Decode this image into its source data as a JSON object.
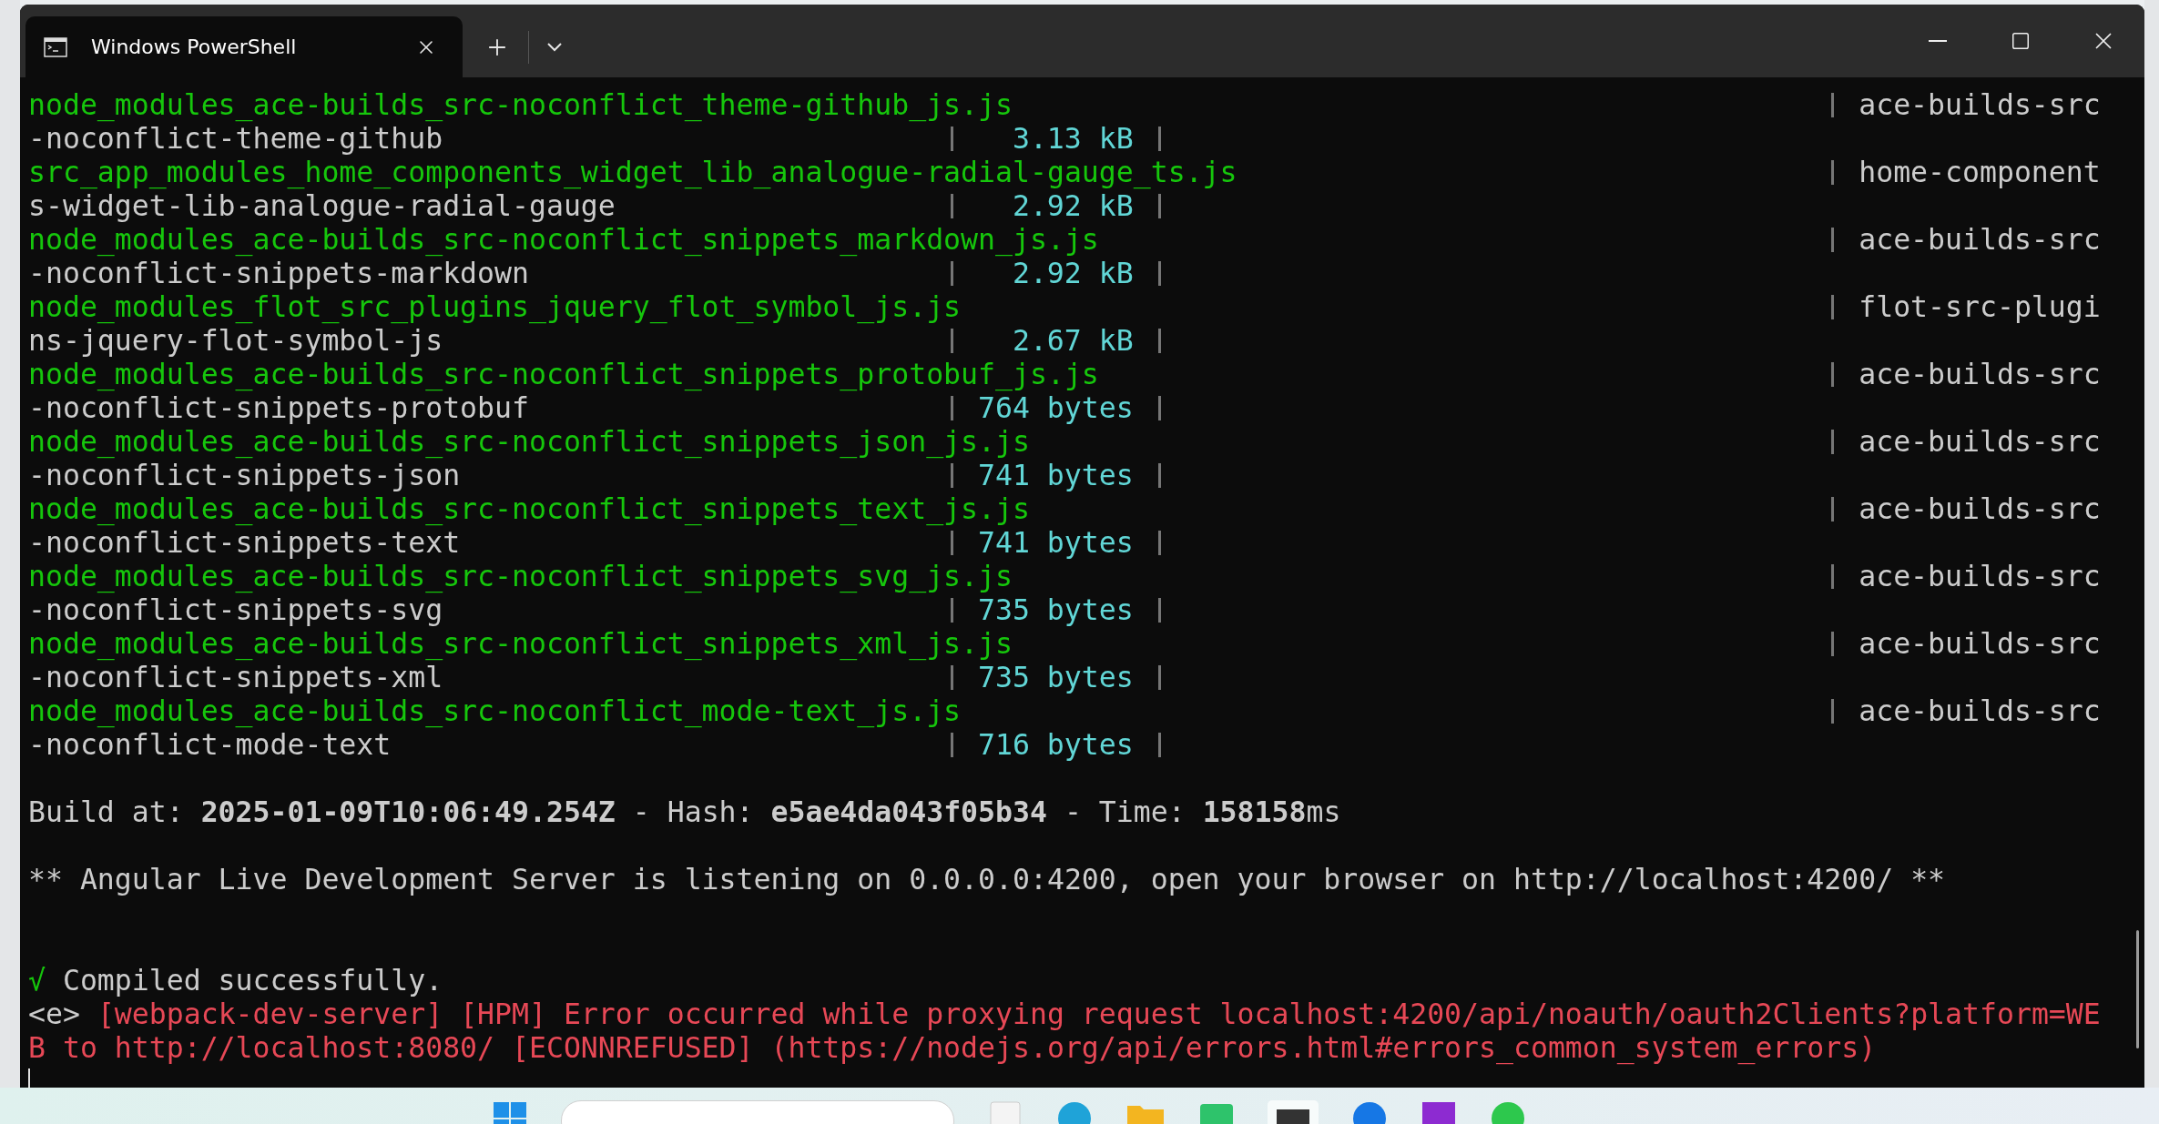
{
  "window": {
    "title": "Windows PowerShell"
  },
  "chunks": [
    {
      "file": "node_modules_ace-builds_src-noconflict_theme-github_js.js",
      "chunk": "-noconflict-theme-github",
      "size": "3.13 kB",
      "names": "ace-builds-src"
    },
    {
      "file": "src_app_modules_home_components_widget_lib_analogue-radial-gauge_ts.js",
      "chunk": "s-widget-lib-analogue-radial-gauge",
      "size": "2.92 kB",
      "names": "home-component"
    },
    {
      "file": "node_modules_ace-builds_src-noconflict_snippets_markdown_js.js",
      "chunk": "-noconflict-snippets-markdown",
      "size": "2.92 kB",
      "names": "ace-builds-src"
    },
    {
      "file": "node_modules_flot_src_plugins_jquery_flot_symbol_js.js",
      "chunk": "ns-jquery-flot-symbol-js",
      "size": "2.67 kB",
      "names": "flot-src-plugi"
    },
    {
      "file": "node_modules_ace-builds_src-noconflict_snippets_protobuf_js.js",
      "chunk": "-noconflict-snippets-protobuf",
      "size": "764 bytes",
      "names": "ace-builds-src"
    },
    {
      "file": "node_modules_ace-builds_src-noconflict_snippets_json_js.js",
      "chunk": "-noconflict-snippets-json",
      "size": "741 bytes",
      "names": "ace-builds-src"
    },
    {
      "file": "node_modules_ace-builds_src-noconflict_snippets_text_js.js",
      "chunk": "-noconflict-snippets-text",
      "size": "741 bytes",
      "names": "ace-builds-src"
    },
    {
      "file": "node_modules_ace-builds_src-noconflict_snippets_svg_js.js",
      "chunk": "-noconflict-snippets-svg",
      "size": "735 bytes",
      "names": "ace-builds-src"
    },
    {
      "file": "node_modules_ace-builds_src-noconflict_snippets_xml_js.js",
      "chunk": "-noconflict-snippets-xml",
      "size": "735 bytes",
      "names": "ace-builds-src"
    },
    {
      "file": "node_modules_ace-builds_src-noconflict_mode-text_js.js",
      "chunk": "-noconflict-mode-text",
      "size": "716 bytes",
      "names": "ace-builds-src"
    }
  ],
  "build_info": "Build at: **2025-01-09T10:06:49.254Z** - Hash: **e5ae4da043f05b34** - Time: **158158**ms",
  "server_message": "** Angular Live Development Server is listening on 0.0.0.0:4200, open your browser on http://localhost:4200/ **",
  "compile": {
    "mark": "√",
    "text": "Compiled successfully."
  },
  "error": {
    "prefix": "<e>",
    "message": "[webpack-dev-server] [HPM] Error occurred while proxying request localhost:4200/api/noauth/oauth2Clients?platform=WEB to http://localhost:8080/ [ECONNREFUSED] (https://nodejs.org/api/errors.html#errors_common_system_errors)"
  }
}
